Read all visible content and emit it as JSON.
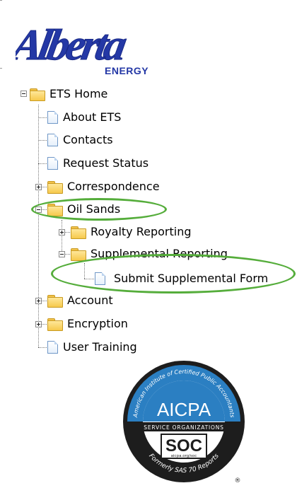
{
  "logo": {
    "word": "Alberta",
    "subtitle": "ENERGY"
  },
  "tree": {
    "root": "ETS Home",
    "items": {
      "about": "About ETS",
      "contacts": "Contacts",
      "request_status": "Request Status",
      "correspondence": "Correspondence",
      "oil_sands": "Oil Sands",
      "royalty_reporting": "Royalty Reporting",
      "supplemental_reporting": "Supplemental Reporting",
      "submit_supplemental_form": "Submit Supplemental Form",
      "account": "Account",
      "encryption": "Encryption",
      "user_training": "User Training"
    }
  },
  "badge": {
    "ring_top": "American Institute of Certified Public Accountants",
    "main": "AICPA",
    "band": "SERVICE ORGANIZATIONS",
    "soc": "SOC",
    "soc_sub": "aicpa.org/soc",
    "ring_bottom": "Formerly SAS 70 Reports",
    "registered": "®"
  },
  "colors": {
    "highlight_ring": "#55ad3b",
    "logo_blue": "#2438a6",
    "badge_dark": "#1d1d1d",
    "badge_blue": "#2b7fc2"
  }
}
